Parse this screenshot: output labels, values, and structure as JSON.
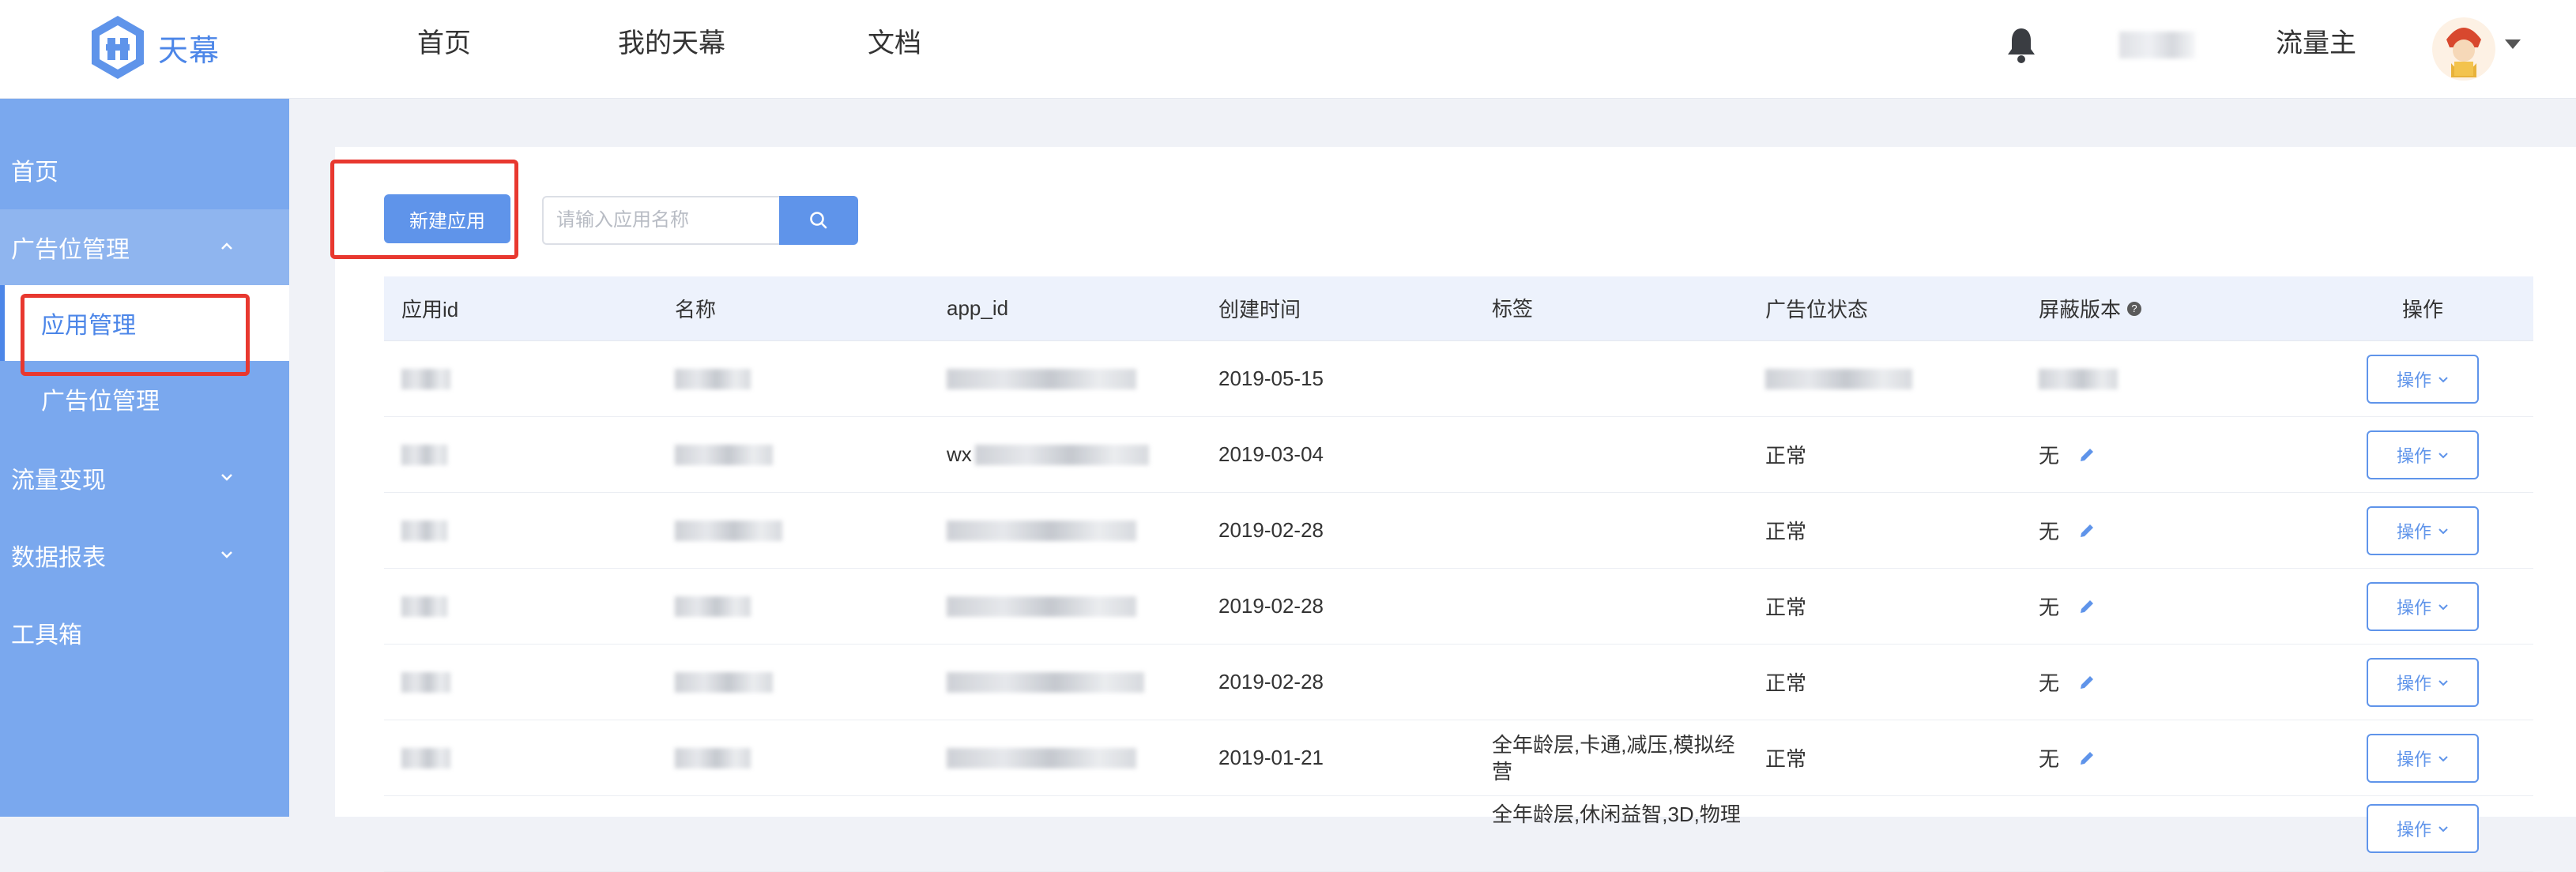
{
  "header": {
    "logo_text": "天幕",
    "nav": [
      "首页",
      "我的天幕",
      "文档"
    ],
    "role": "流量主",
    "icons": [
      "bell-icon",
      "avatar",
      "caret-down-icon"
    ]
  },
  "sidebar": {
    "items": [
      {
        "label": "首页"
      },
      {
        "label": "广告位管理",
        "expanded": true
      },
      {
        "label": "应用管理",
        "active": true
      },
      {
        "label": "广告位管理"
      },
      {
        "label": "流量变现"
      },
      {
        "label": "数据报表"
      },
      {
        "label": "工具箱"
      }
    ]
  },
  "toolbar": {
    "new_app_label": "新建应用",
    "search_placeholder": "请输入应用名称"
  },
  "table": {
    "headers": [
      "应用id",
      "名称",
      "app_id",
      "创建时间",
      "标签",
      "广告位状态",
      "屏蔽版本",
      "操作"
    ],
    "rows": [
      {
        "created": "2019-05-15",
        "tags": "",
        "status": "",
        "version": "",
        "op": "操作"
      },
      {
        "app_id_prefix": "wx",
        "created": "2019-03-04",
        "tags": "",
        "status": "正常",
        "version": "无",
        "op": "操作"
      },
      {
        "created": "2019-02-28",
        "tags": "",
        "status": "正常",
        "version": "无",
        "op": "操作"
      },
      {
        "created": "2019-02-28",
        "tags": "",
        "status": "正常",
        "version": "无",
        "op": "操作"
      },
      {
        "created": "2019-02-28",
        "tags": "",
        "status": "正常",
        "version": "无",
        "op": "操作"
      },
      {
        "created": "2019-01-21",
        "tags": "全年龄层,卡通,减压,模拟经营",
        "status": "正常",
        "version": "无",
        "op": "操作"
      },
      {
        "created": "",
        "tags": "全年龄层,休闲益智,3D,物理",
        "status": "",
        "version": "",
        "op": "操作"
      }
    ]
  },
  "colors": {
    "primary": "#5f94ea",
    "sidebar": "#7aa8ee",
    "highlight": "#e8382f"
  }
}
